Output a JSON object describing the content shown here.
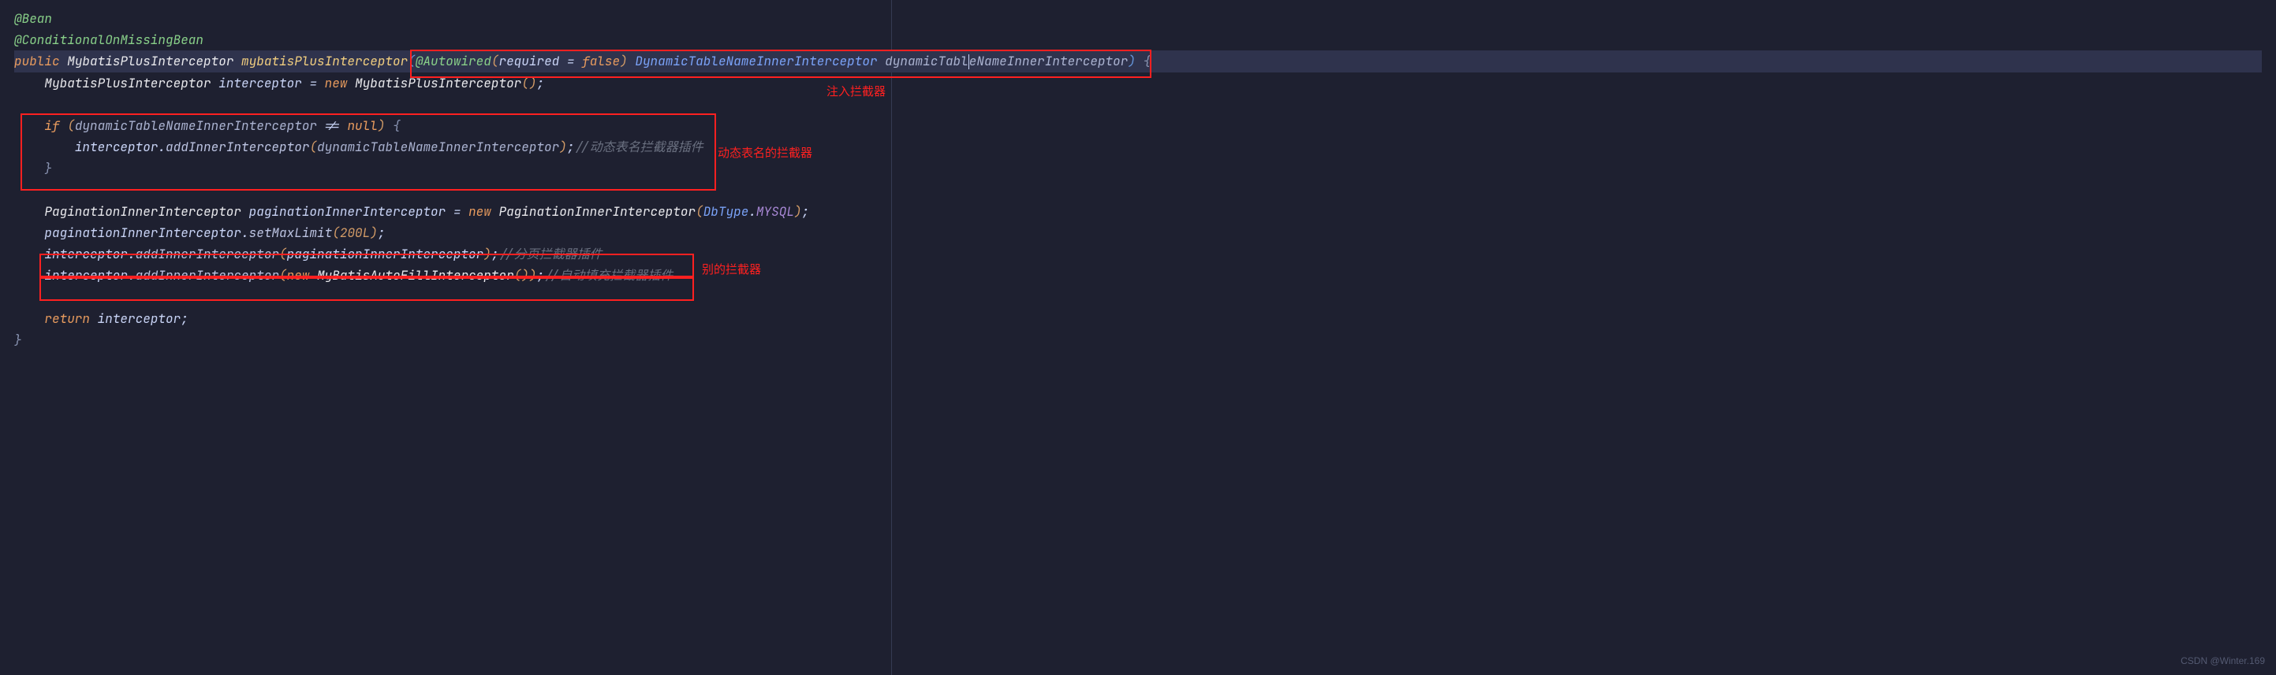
{
  "code": {
    "anno_bean": "@Bean",
    "anno_conditional": "@ConditionalOnMissingBean",
    "kw_public": "public",
    "type_mbpi": "MybatisPlusInterceptor",
    "method_name": "mybatisPlusInterceptor",
    "anno_autowired": "@Autowired",
    "autowired_param": "required",
    "kw_false": "false",
    "type_dtnii": "DynamicTableNameInnerInterceptor",
    "param_dtnii": "dynamicTableNameInnerInterceptor",
    "var_interceptor": "interceptor",
    "kw_new": "new",
    "kw_if": "if",
    "kw_null": "null",
    "kw_return": "return",
    "methodcall_addInner": "addInnerInterceptor",
    "comment_dyn": "//动态表名拦截器插件",
    "type_pii": "PaginationInnerInterceptor",
    "var_pii": "paginationInnerInterceptor",
    "method_setmax": "setMaxLimit",
    "num_200L": "200L",
    "type_dbtype": "DbType",
    "enum_mysql": "MYSQL",
    "comment_page": "//分页拦截器插件",
    "type_autofill": "MyBatisAutoFillInterceptor",
    "comment_autofill": "//自动填充拦截器插件"
  },
  "annotations": {
    "label_inject": "注入拦截器",
    "label_dynamic": "动态表名的拦截器",
    "label_other": "别的拦截器"
  },
  "watermark": "CSDN @Winter.169"
}
